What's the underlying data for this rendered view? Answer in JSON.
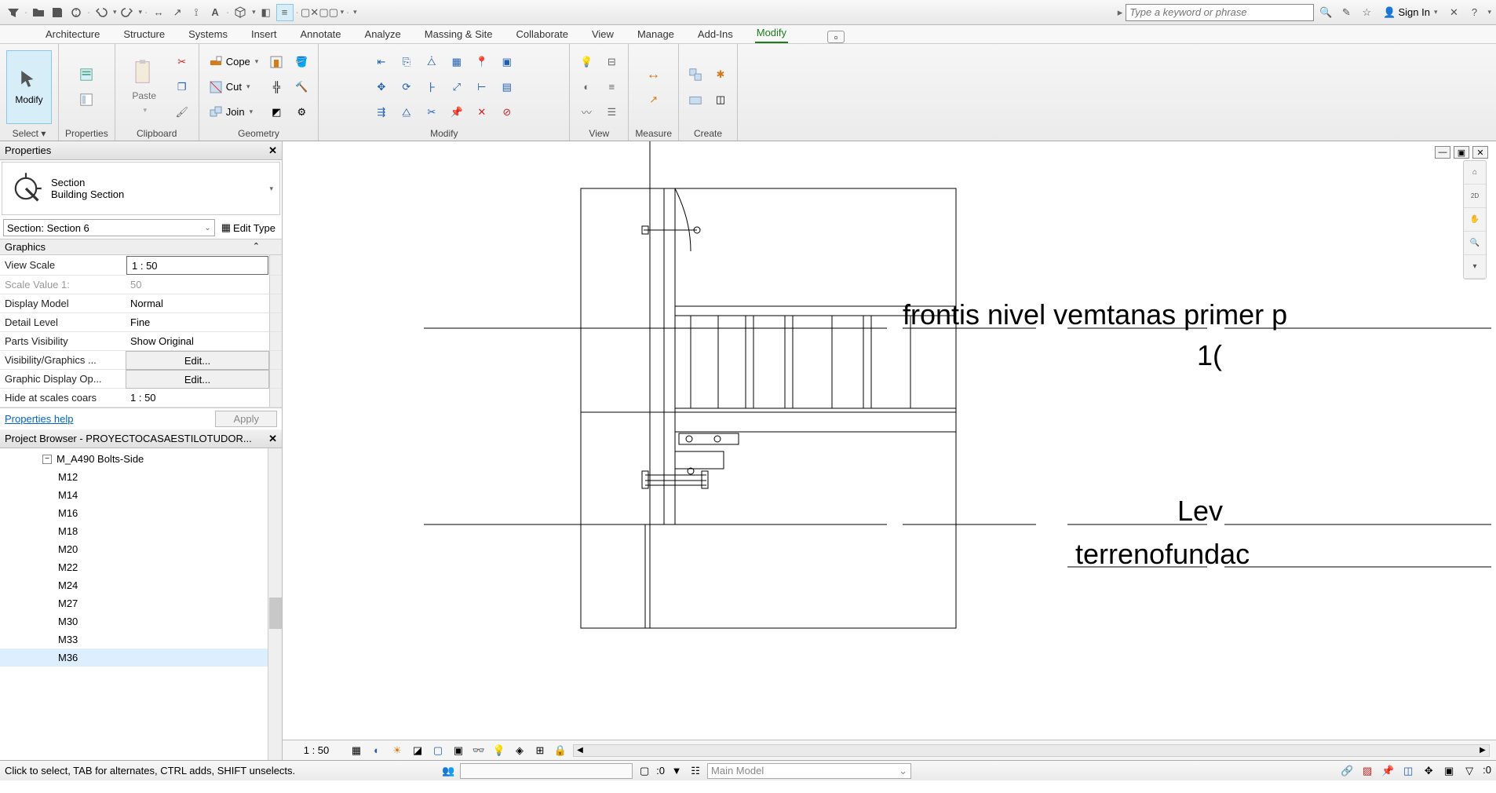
{
  "qat": {
    "search_placeholder": "Type a keyword or phrase",
    "signin": "Sign In"
  },
  "tabs": {
    "items": [
      "Architecture",
      "Structure",
      "Systems",
      "Insert",
      "Annotate",
      "Analyze",
      "Massing & Site",
      "Collaborate",
      "View",
      "Manage",
      "Add-Ins",
      "Modify"
    ],
    "active_index": 11
  },
  "ribbon": {
    "select": {
      "label": "Select ▾",
      "modify": "Modify"
    },
    "properties": {
      "label": "Properties"
    },
    "clipboard": {
      "label": "Clipboard",
      "paste": "Paste"
    },
    "geometry": {
      "label": "Geometry",
      "cope": "Cope",
      "cut": "Cut",
      "join": "Join"
    },
    "modify": {
      "label": "Modify"
    },
    "view": {
      "label": "View"
    },
    "measure": {
      "label": "Measure"
    },
    "create": {
      "label": "Create"
    }
  },
  "properties": {
    "title": "Properties",
    "type_family": "Section",
    "type_name": "Building Section",
    "instance": "Section: Section 6",
    "edit_type": "Edit Type",
    "group": "Graphics",
    "rows": [
      {
        "name": "View Scale",
        "value": "1 : 50",
        "input": true
      },
      {
        "name": "Scale Value    1:",
        "value": "50",
        "gray": true
      },
      {
        "name": "Display Model",
        "value": "Normal"
      },
      {
        "name": "Detail Level",
        "value": "Fine"
      },
      {
        "name": "Parts Visibility",
        "value": "Show Original"
      },
      {
        "name": "Visibility/Graphics ...",
        "value": "Edit...",
        "button": true
      },
      {
        "name": "Graphic Display Op...",
        "value": "Edit...",
        "button": true
      },
      {
        "name": "Hide at scales coars",
        "value": "1 : 50",
        "cut": true
      }
    ],
    "help": "Properties help",
    "apply": "Apply"
  },
  "browser": {
    "title": "Project Browser - PROYECTOCASAESTILOTUDOR...",
    "header": "M_A490 Bolts-Side",
    "items": [
      "M12",
      "M14",
      "M16",
      "M18",
      "M20",
      "M22",
      "M24",
      "M27",
      "M30",
      "M33",
      "M36"
    ]
  },
  "canvas": {
    "level1_label": "frontis nivel vemtanas primer p",
    "level1_elev": "1(",
    "level2_label": "Lev",
    "level3_label": "terrenofundac"
  },
  "vcb": {
    "scale": "1 : 50"
  },
  "status": {
    "msg": "Click to select, TAB for alternates, CTRL adds, SHIFT unselects.",
    "count": ":0",
    "workset": "Main Model",
    "filter_count": ":0"
  }
}
